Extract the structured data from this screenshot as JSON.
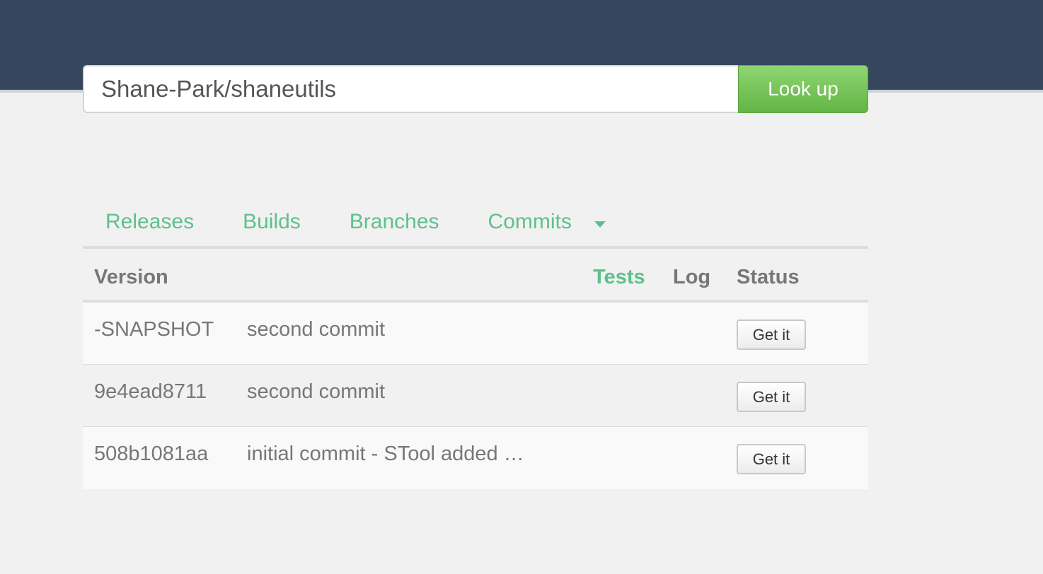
{
  "search": {
    "value": "Shane-Park/shaneutils",
    "button_label": "Look up"
  },
  "tabs": [
    {
      "label": "Releases"
    },
    {
      "label": "Builds"
    },
    {
      "label": "Branches"
    },
    {
      "label": "Commits",
      "has_dropdown": true
    }
  ],
  "table": {
    "columns": {
      "version": "Version",
      "tests": "Tests",
      "log": "Log",
      "status": "Status"
    },
    "rows": [
      {
        "version": "-SNAPSHOT",
        "message": "second commit",
        "action": "Get it"
      },
      {
        "version": "9e4ead8711",
        "message": "second commit",
        "action": "Get it"
      },
      {
        "version": "508b1081aa",
        "message": "initial commit - STool added …",
        "action": "Get it"
      }
    ]
  },
  "colors": {
    "header_bg": "#36465d",
    "accent_green": "#5fc08d",
    "button_green": "#62b545"
  },
  "icons": {
    "commits_dropdown": "caret-down-icon"
  }
}
